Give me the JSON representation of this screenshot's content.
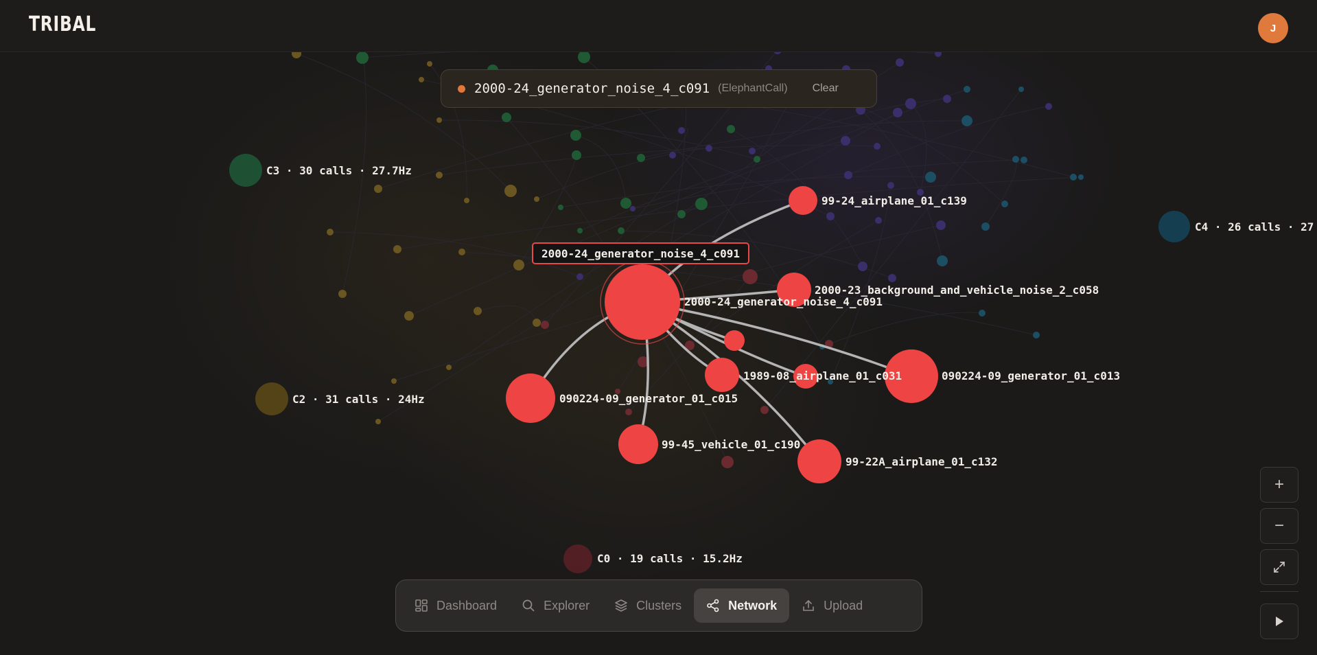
{
  "app": {
    "logo": "TRIBAL",
    "avatar_initial": "J"
  },
  "selection": {
    "name": "2000-24_generator_noise_4_c091",
    "type": "(ElephantCall)",
    "clear_label": "Clear"
  },
  "focus_tag": "2000-24_generator_noise_4_c091",
  "clusters": [
    {
      "label": "C3 · 30 calls · 27.7Hz",
      "color": "#1e5a3a"
    },
    {
      "label": "C2 · 31 calls · 24Hz",
      "color": "#5e4a18"
    },
    {
      "label": "C4 · 26 calls · 27",
      "color": "#14465a"
    },
    {
      "label": "C0 · 19 calls · 15.2Hz",
      "color": "#5a2027"
    }
  ],
  "nodes": [
    {
      "label": "2000-24_generator_noise_4_c091"
    },
    {
      "label": "99-24_airplane_01_c139"
    },
    {
      "label": "2000-23_background_and_vehicle_noise_2_c058"
    },
    {
      "label": "1989-08_airplane_01_c031"
    },
    {
      "label": "090224-09_generator_01_c013"
    },
    {
      "label": "090224-09_generator_01_c015"
    },
    {
      "label": "99-45_vehicle_01_c190"
    },
    {
      "label": "99-22A_airplane_01_c132"
    },
    {
      "label": ""
    }
  ],
  "colors": {
    "accent": "#e0783a",
    "node": "#ef4444",
    "edge": "#b5b5b5"
  },
  "nav": [
    {
      "label": "Dashboard",
      "icon": "dashboard-grid-icon",
      "active": false
    },
    {
      "label": "Explorer",
      "icon": "search-icon",
      "active": false
    },
    {
      "label": "Clusters",
      "icon": "layers-icon",
      "active": false
    },
    {
      "label": "Network",
      "icon": "share-network-icon",
      "active": true
    },
    {
      "label": "Upload",
      "icon": "upload-icon",
      "active": false
    }
  ],
  "controls": {
    "zoom_in": "+",
    "zoom_out": "−"
  }
}
